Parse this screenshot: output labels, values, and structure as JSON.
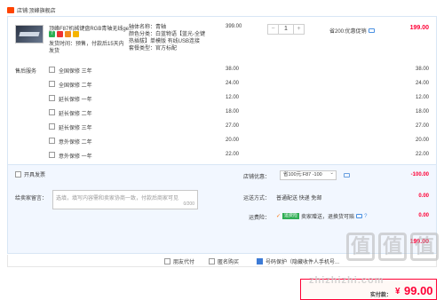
{
  "shop": {
    "label": "店铺:",
    "name": "顶峰旗舰店"
  },
  "product": {
    "title": "顶峰F87机械键盘RGB青轴无线ge...",
    "badge_letter": "7",
    "note1": "发货时间：预售，付款后15天内",
    "note2": "发货",
    "spec_lines": [
      "轴体名称：青轴",
      "颜色分类：白蓝物语【蓝光-全键",
      "热插拔】单模版 有线USB连接",
      "套餐类型：官方标配"
    ],
    "unit_price": "399.00",
    "quantity": "1",
    "minus": "−",
    "plus": "+",
    "discount_text": "省200:优惠促销",
    "line_total": "199.00"
  },
  "services": {
    "label": "售后服务",
    "items": [
      {
        "name": "全国保修 三年",
        "price": "38.00",
        "total": "38.00"
      },
      {
        "name": "全国保修 二年",
        "price": "24.00",
        "total": "24.00"
      },
      {
        "name": "延长保修 一年",
        "price": "12.00",
        "total": "12.00"
      },
      {
        "name": "延长保修 二年",
        "price": "18.00",
        "total": "18.00"
      },
      {
        "name": "延长保修 三年",
        "price": "27.00",
        "total": "27.00"
      },
      {
        "name": "意外保修 二年",
        "price": "20.00",
        "total": "20.00"
      },
      {
        "name": "意外保修 一年",
        "price": "22.00",
        "total": "22.00"
      }
    ]
  },
  "invoice": {
    "label": "开具发票"
  },
  "message": {
    "label": "给卖家留言：",
    "placeholder": "选填，填写内容需和卖家协商一致，付款后商家可见",
    "counter": "0/200"
  },
  "coupon": {
    "label": "店铺优惠：",
    "selected": "省100元:F87 -100",
    "amount": "-100.00"
  },
  "shipping": {
    "label": "运送方式：",
    "text": "普通配送 快递 免邮",
    "amount": "0.00"
  },
  "insurance": {
    "label": "运费险：",
    "check": "✓",
    "tag": "运费险",
    "text": "卖家赠送，退换货可赔",
    "amount": "0.00"
  },
  "store_total": "199.00",
  "footer": {
    "opt1": "朋友代付",
    "opt2": "匿名购买",
    "opt3": "号码保护（隐藏收件人手机号..."
  },
  "payment": {
    "label": "实付款：",
    "currency": "¥",
    "amount": "99.00"
  },
  "watermark": {
    "glyphs": [
      "值",
      "值",
      "值"
    ],
    "url": "zhizhizhi.com"
  }
}
